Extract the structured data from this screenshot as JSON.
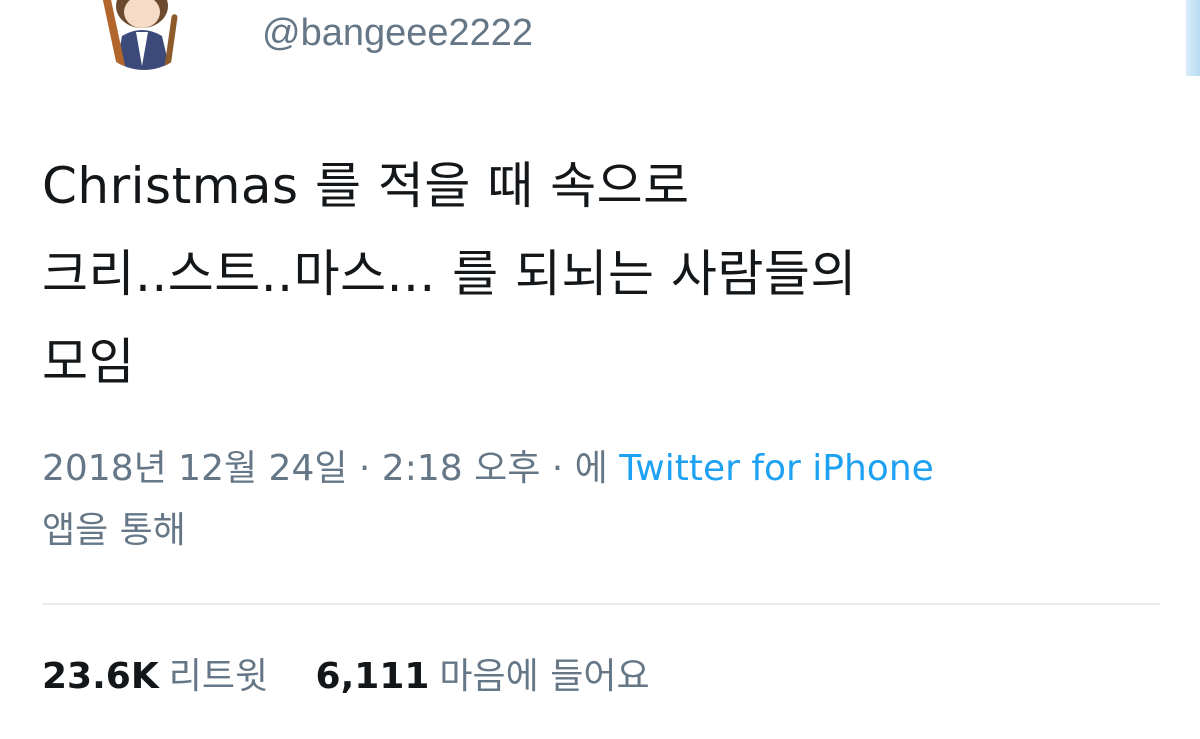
{
  "user": {
    "handle": "@bangeee2222"
  },
  "tweet": {
    "lines": [
      "Christmas 를 적을 때 속으로",
      "크리..스트..마스... 를 되뇌는 사람들의",
      "모임"
    ]
  },
  "meta": {
    "line1_prefix": "2018년 12월 24일 · 2:18 오후 · 에 ",
    "source": "Twitter for iPhone",
    "line2": "앱을 통해"
  },
  "stats": {
    "retweets_count": "23.6K",
    "retweets_label": "리트윗",
    "likes_count": "6,111",
    "likes_label": "마음에 들어요"
  },
  "colors": {
    "text": "#14171a",
    "secondary": "#657786",
    "link": "#1da1f2",
    "divider": "#e6ecf0"
  },
  "icons": {
    "avatar": "avatar-illustration"
  }
}
